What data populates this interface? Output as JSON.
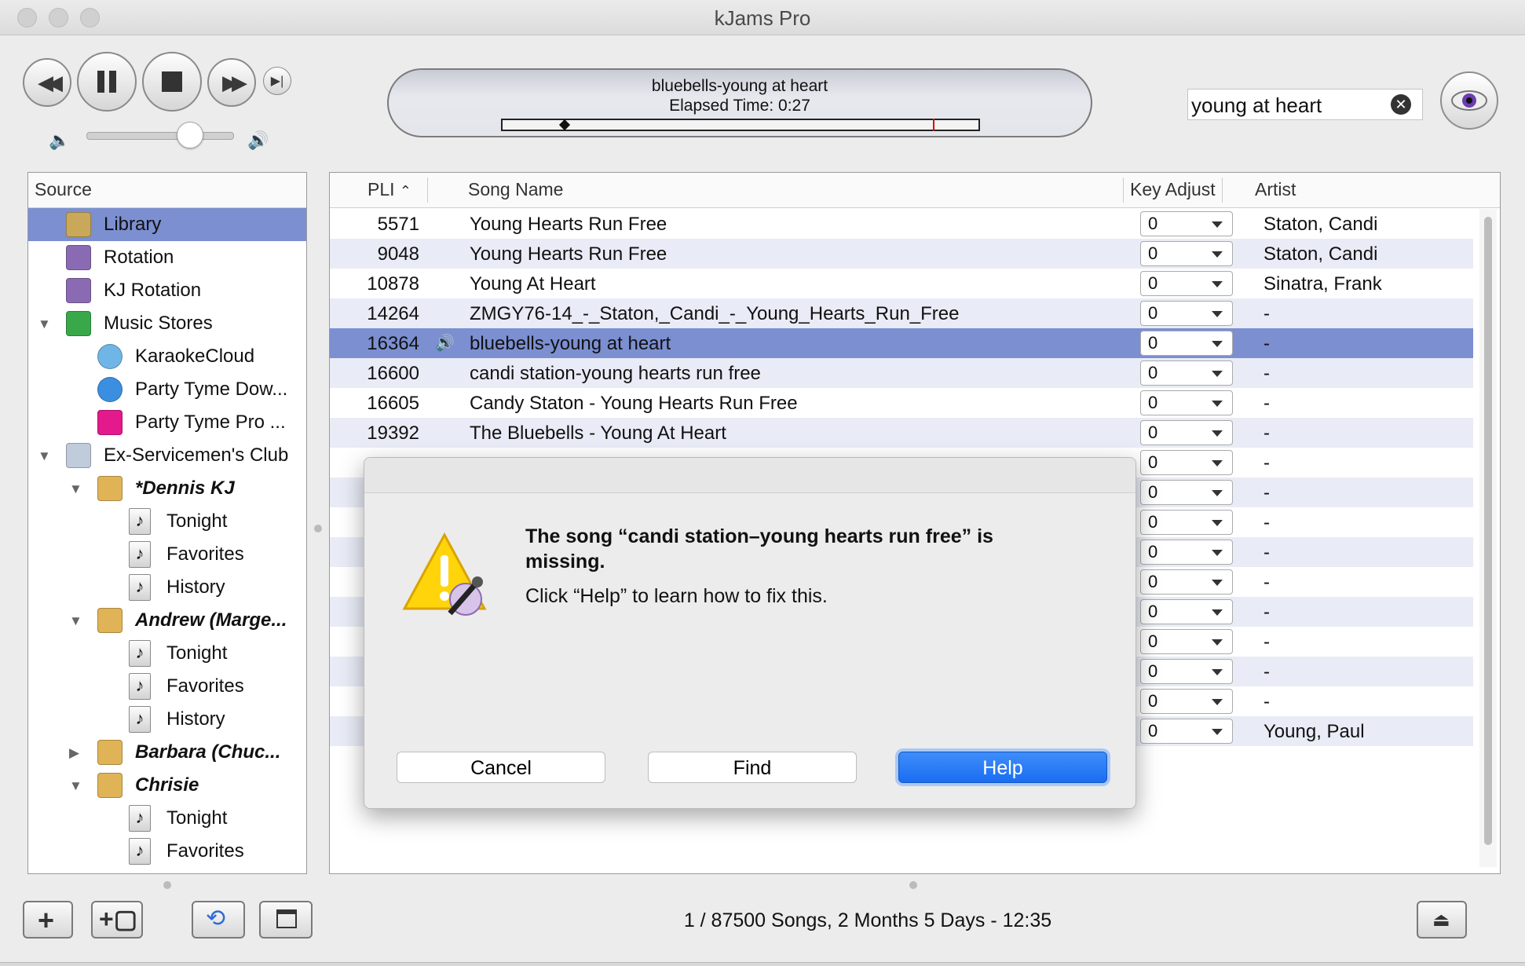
{
  "window": {
    "title": "kJams Pro"
  },
  "display": {
    "song": "bluebells-young at heart",
    "elapsed": "Elapsed Time: 0:27"
  },
  "search": {
    "value": "young at heart"
  },
  "sidebar": {
    "header": "Source",
    "items": [
      {
        "label": "Library",
        "icon": "library-icon",
        "selected": true
      },
      {
        "label": "Rotation",
        "icon": "microphone-icon"
      },
      {
        "label": "KJ Rotation",
        "icon": "microphone-icon"
      },
      {
        "label": "Music Stores",
        "icon": "store-icon",
        "expanded": true
      },
      {
        "label": "KaraokeCloud",
        "icon": "cloud-icon"
      },
      {
        "label": "Party Tyme Dow...",
        "icon": "download-icon"
      },
      {
        "label": "Party Tyme Pro ...",
        "icon": "party-tyme-icon"
      },
      {
        "label": "Ex-Servicemen's Club",
        "icon": "venue-icon",
        "expanded": true
      },
      {
        "label": "*Dennis KJ",
        "icon": "singer-icon",
        "expanded": true
      },
      {
        "label": "Tonight",
        "icon": "playlist-icon"
      },
      {
        "label": "Favorites",
        "icon": "playlist-icon"
      },
      {
        "label": "History",
        "icon": "playlist-icon"
      },
      {
        "label": "Andrew (Marge...",
        "icon": "singer-icon",
        "expanded": true
      },
      {
        "label": "Tonight",
        "icon": "playlist-icon"
      },
      {
        "label": "Favorites",
        "icon": "playlist-icon"
      },
      {
        "label": "History",
        "icon": "playlist-icon"
      },
      {
        "label": "Barbara (Chuc...",
        "icon": "singer-icon",
        "expanded": false
      },
      {
        "label": "Chrisie",
        "icon": "singer-icon",
        "expanded": true
      },
      {
        "label": "Tonight",
        "icon": "playlist-icon"
      },
      {
        "label": "Favorites",
        "icon": "playlist-icon"
      }
    ]
  },
  "table": {
    "columns": {
      "pli": "PLI",
      "song": "Song Name",
      "key": "Key Adjust",
      "artist": "Artist"
    },
    "rows": [
      {
        "pli": "5571",
        "song": "Young Hearts Run Free",
        "key": "0",
        "artist": "Staton, Candi"
      },
      {
        "pli": "9048",
        "song": "Young Hearts Run Free",
        "key": "0",
        "artist": "Staton, Candi"
      },
      {
        "pli": "10878",
        "song": "Young At Heart",
        "key": "0",
        "artist": "Sinatra, Frank"
      },
      {
        "pli": "14264",
        "song": "ZMGY76-14_-_Staton,_Candi_-_Young_Hearts_Run_Free",
        "key": "0",
        "artist": "-"
      },
      {
        "pli": "16364",
        "song": "bluebells-young at heart",
        "key": "0",
        "artist": "-",
        "playing": true
      },
      {
        "pli": "16600",
        "song": "candi station-young hearts run free",
        "key": "0",
        "artist": "-"
      },
      {
        "pli": "16605",
        "song": "Candy Staton - Young Hearts Run Free",
        "key": "0",
        "artist": "-"
      },
      {
        "pli": "19392",
        "song": "The Bluebells - Young At Heart",
        "key": "0",
        "artist": "-"
      },
      {
        "pli": "",
        "song": "",
        "key": "0",
        "artist": "-"
      },
      {
        "pli": "",
        "song": "",
        "key": "0",
        "artist": "-"
      },
      {
        "pli": "",
        "song": "",
        "key": "0",
        "artist": "-"
      },
      {
        "pli": "",
        "song": "",
        "key": "0",
        "artist": "-"
      },
      {
        "pli": "",
        "song": "",
        "key": "0",
        "artist": "-"
      },
      {
        "pli": "",
        "song": "",
        "key": "0",
        "artist": "-"
      },
      {
        "pli": "",
        "song": "",
        "key": "0",
        "artist": "-"
      },
      {
        "pli": "",
        "song": "",
        "key": "0",
        "artist": "-"
      },
      {
        "pli": "",
        "song": "",
        "key": "0",
        "artist": "-"
      },
      {
        "pli": "",
        "song": "",
        "key": "0",
        "artist": "Young, Paul"
      }
    ]
  },
  "dialog": {
    "title": "The song “candi station–young hearts run free” is missing.",
    "message": "Click “Help” to learn how to fix this.",
    "cancel": "Cancel",
    "find": "Find",
    "help": "Help"
  },
  "status": "1 / 87500 Songs, 2 Months 5 Days - 12:35",
  "colors": {
    "selection": "#7b8fd1",
    "alt_row": "#e9ecf6",
    "accent": "#1a6df2"
  }
}
